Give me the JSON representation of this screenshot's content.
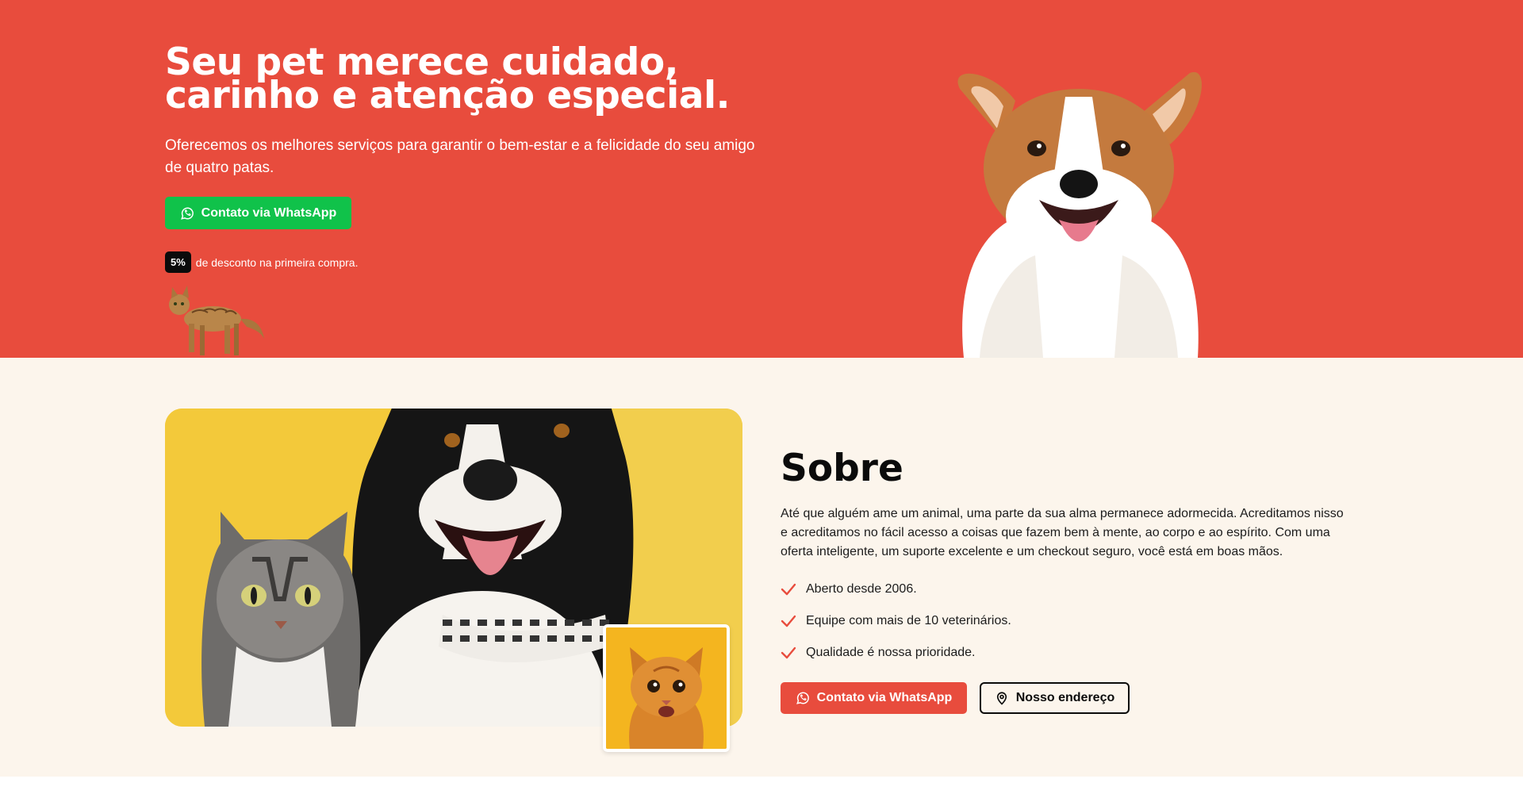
{
  "colors": {
    "hero_bg": "#e84c3d",
    "whatsapp_green": "#10c24a",
    "accent_red": "#e84c3d",
    "about_bg": "#fcf5ec",
    "check_color": "#e84c3d"
  },
  "hero": {
    "title": "Seu pet merece cuidado, carinho e atenção especial.",
    "subtitle": "Oferecemos os melhores serviços para garantir o bem-estar e a felicidade do seu amigo de quatro patas.",
    "whatsapp_button": {
      "label": "Contato via WhatsApp",
      "icon": "whatsapp-icon"
    },
    "discount": {
      "badge": "5%",
      "text": "de desconto na primeira compra."
    }
  },
  "about": {
    "title": "Sobre",
    "text": "Até que alguém ame um animal, uma parte da sua alma permanece adormecida. Acreditamos nisso e acreditamos no fácil acesso a coisas que fazem bem à mente, ao corpo e ao espírito. Com uma oferta inteligente, um suporte excelente e um checkout seguro, você está em boas mãos.",
    "items": [
      {
        "label": "Aberto desde 2006.",
        "icon": "check-icon"
      },
      {
        "label": "Equipe com mais de 10 veterinários.",
        "icon": "check-icon"
      },
      {
        "label": "Qualidade é nossa prioridade.",
        "icon": "check-icon"
      }
    ],
    "whatsapp_button": {
      "label": "Contato via WhatsApp",
      "icon": "whatsapp-icon"
    },
    "address_button": {
      "label": "Nosso endereço",
      "icon": "map-pin-icon"
    }
  }
}
